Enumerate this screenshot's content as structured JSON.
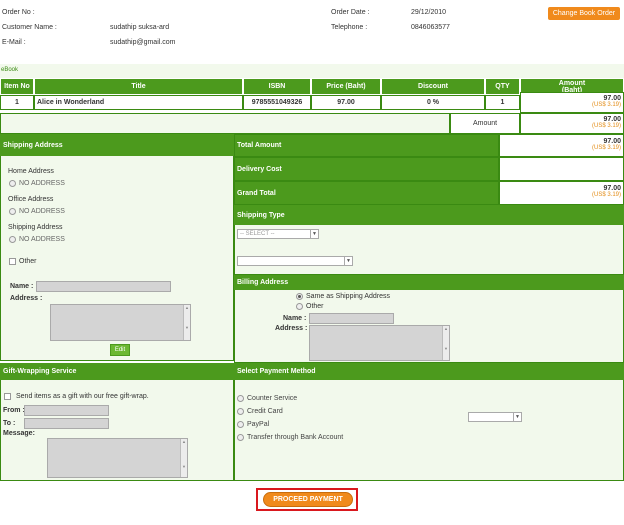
{
  "order": {
    "order_no_label": "Order No :",
    "order_no_value": "",
    "customer_label": "Customer Name :",
    "customer_value": "sudathip suksa-ard",
    "email_label": "E-Mail :",
    "email_value": "sudathip@gmail.com",
    "date_label": "Order Date :",
    "date_value": "29/12/2010",
    "telephone_label": "Telephone :",
    "telephone_value": "0846063577",
    "change_button": "Change Book Order"
  },
  "ebook": {
    "section_label": "eBook",
    "headers": [
      "Item No",
      "Title",
      "ISBN",
      "Price (Baht)",
      "Discount",
      "QTY",
      "Amount\n(Baht)"
    ],
    "row": {
      "item_no": "1",
      "title": "Alice in Wonderland",
      "isbn": "9785551049326",
      "price": "97.00",
      "discount": "0 %",
      "qty": "1",
      "amount": "97.00",
      "amount_usd": "(US$ 3.19)"
    },
    "amount_label": "Amount",
    "amount_total": "97.00",
    "amount_total_usd": "(US$ 3.19)"
  },
  "totals": {
    "total_amount_label": "Total Amount",
    "total_amount": "97.00",
    "total_amount_usd": "(US$ 3.19)",
    "delivery_label": "Delivery Cost",
    "grand_total_label": "Grand Total",
    "grand_total": "97.00",
    "grand_total_usd": "(US$ 3.19)"
  },
  "shipping": {
    "header": "Shipping Address",
    "home_label": "Home Address",
    "office_label": "Office Address",
    "shipping_label": "Shipping Address",
    "no_address": "NO ADDRESS",
    "other_label": "Other",
    "name_label": "Name :",
    "address_label": "Address :",
    "edit_button": "Edit"
  },
  "shipping_type": {
    "header": "Shipping Type",
    "select_placeholder": "-- SELECT --"
  },
  "billing": {
    "header": "Billing Address",
    "same_label": "Same as Shipping Address",
    "other_label": "Other",
    "name_label": "Name :",
    "address_label": "Address :"
  },
  "gift": {
    "header": "Gift-Wrapping Service",
    "send_label": "Send items as a gift with our free gift-wrap.",
    "from_label": "From :",
    "to_label": "To :",
    "message_label": "Message:"
  },
  "payment": {
    "header": "Select Payment Method",
    "options": [
      "Counter Service",
      "Credit Card",
      "PayPal",
      "Transfer through Bank Account"
    ]
  },
  "proceed_button": "PROCEED PAYMENT",
  "colors": {
    "green": "#4c9a1d",
    "orange": "#f08a1c",
    "highlight_red": "#d9181e"
  }
}
